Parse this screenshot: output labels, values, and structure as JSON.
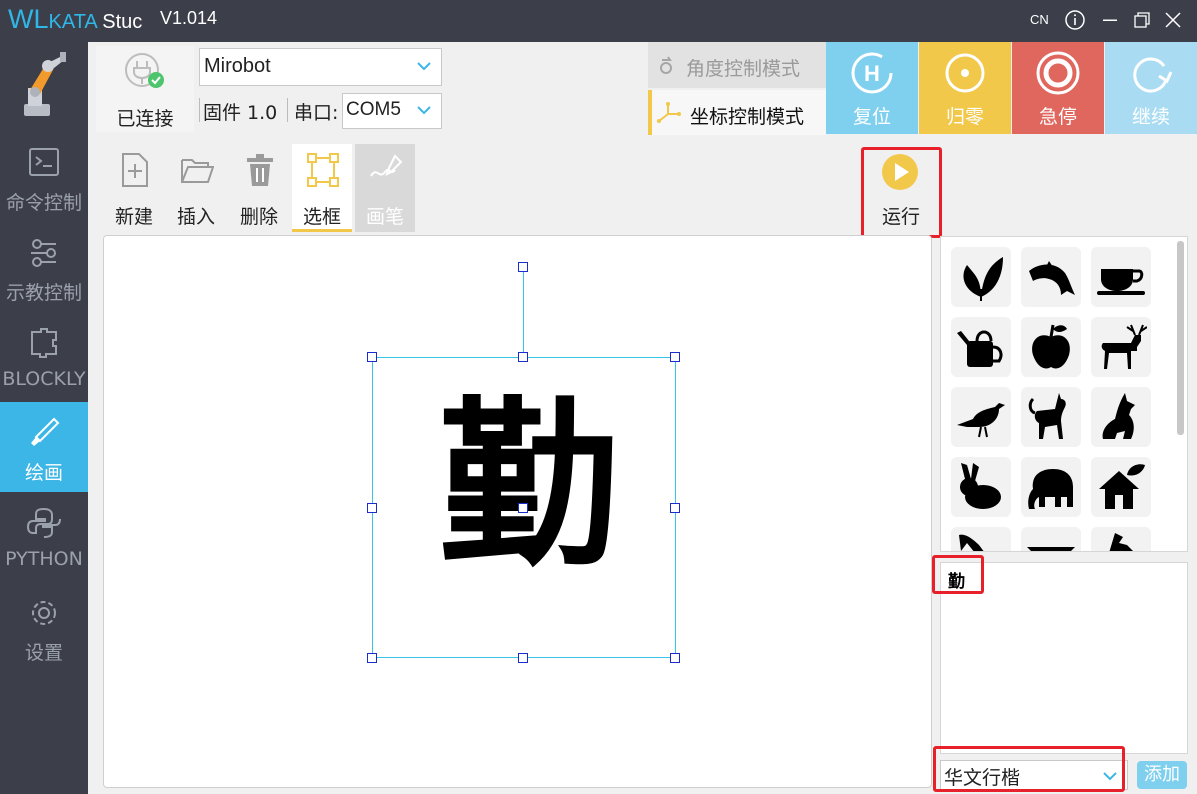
{
  "window": {
    "logo_wl": "WL",
    "logo_kata": "KATA",
    "logo_stu": " Stuc",
    "version": "V1.014",
    "lang": "CN"
  },
  "sidebar": {
    "items": [
      {
        "label": "命令控制",
        "icon": "terminal-icon"
      },
      {
        "label": "示教控制",
        "icon": "teach-icon"
      },
      {
        "label": "BLOCKLY",
        "icon": "puzzle-icon"
      },
      {
        "label": "绘画",
        "icon": "brush-icon",
        "active": true
      },
      {
        "label": "PYTHON",
        "icon": "python-icon"
      },
      {
        "label": "设置",
        "icon": "gear-icon"
      }
    ]
  },
  "connection": {
    "status": "已连接",
    "device": "Mirobot",
    "firmware": "固件 1.0",
    "port_label": "串口:",
    "port": "COM5"
  },
  "modes": {
    "angle": "角度控制模式",
    "coord": "坐标控制模式"
  },
  "actions": {
    "reset": "复位",
    "zero": "归零",
    "estop": "急停",
    "resume": "继续"
  },
  "colors": {
    "reset": "#7fd0ee",
    "zero": "#f1c84a",
    "estop": "#e0675e",
    "resume": "#a9dcf2",
    "accent": "#3cb6e6"
  },
  "toolbar": {
    "new": "新建",
    "insert": "插入",
    "delete": "删除",
    "select": "选框",
    "pen": "画笔",
    "run": "运行"
  },
  "canvas": {
    "glyph": "勤"
  },
  "shapes": [
    "leaf",
    "dolphin",
    "teacup",
    "watering-can",
    "apple",
    "deer",
    "bird",
    "cat",
    "dog",
    "rabbit",
    "elephant",
    "house"
  ],
  "text_panel": {
    "value": "勤",
    "font": "华文行楷",
    "add": "添加"
  }
}
